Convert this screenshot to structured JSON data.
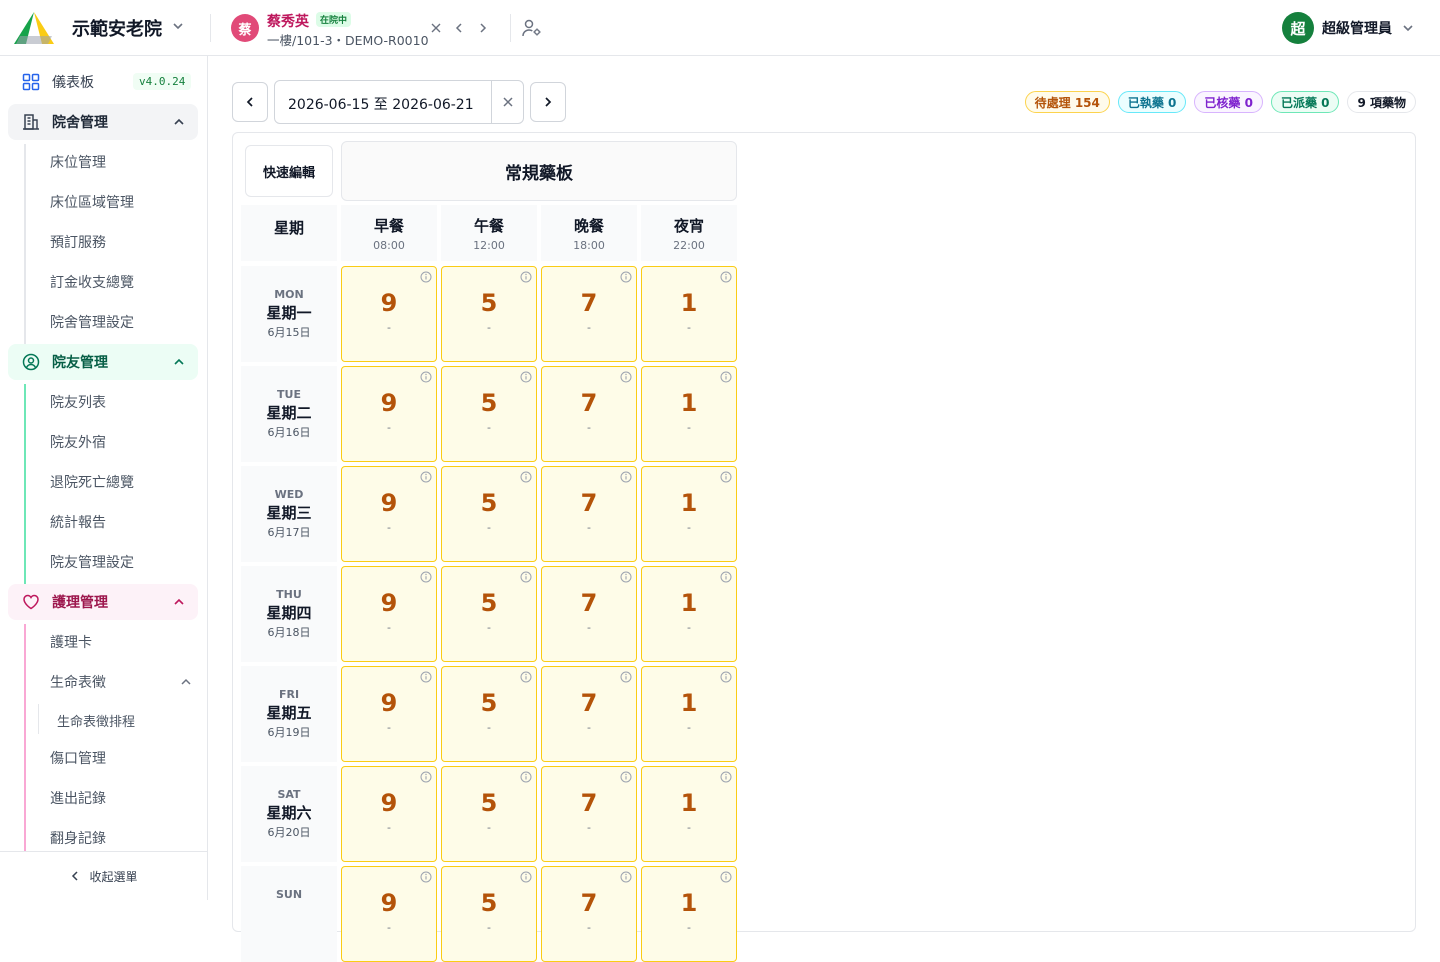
{
  "org": {
    "name": "示範安老院"
  },
  "patient": {
    "avatar": "蔡",
    "name": "蔡秀英",
    "status": "在院中",
    "location": "一樓/101-3・DEMO-R0010"
  },
  "admin": {
    "avatar": "超",
    "name": "超級管理員"
  },
  "sidebar": {
    "dashboard": "儀表板",
    "version": "v4.0.24",
    "groups": [
      {
        "label": "院舍管理",
        "items": [
          "床位管理",
          "床位區域管理",
          "預訂服務",
          "訂金收支總覽",
          "院舍管理設定"
        ]
      },
      {
        "label": "院友管理",
        "items": [
          "院友列表",
          "院友外宿",
          "退院死亡總覽",
          "統計報告",
          "院友管理設定"
        ]
      },
      {
        "label": "護理管理",
        "items": [
          "護理卡",
          "生命表徵",
          "生命表徵排程",
          "傷口管理",
          "進出記錄",
          "翻身記錄"
        ]
      }
    ],
    "collapse": "收起選單"
  },
  "toolbar": {
    "date_range": "2026-06-15 至 2026-06-21",
    "pills": [
      {
        "label": "待處理 154",
        "color": "#b45309",
        "bg": "#fffbeb",
        "border": "#fcd34d"
      },
      {
        "label": "已執藥 0",
        "color": "#0e7490",
        "bg": "#ecfeff",
        "border": "#67e8f9"
      },
      {
        "label": "已核藥 0",
        "color": "#7e22ce",
        "bg": "#faf5ff",
        "border": "#d8b4fe"
      },
      {
        "label": "已派藥 0",
        "color": "#047857",
        "bg": "#ecfdf5",
        "border": "#6ee7b7"
      },
      {
        "label": "9 項藥物",
        "color": "#111827",
        "bg": "#ffffff",
        "border": "#e5e7eb"
      }
    ]
  },
  "board": {
    "quick_edit": "快速編輯",
    "title": "常規藥板",
    "weekday_header": "星期",
    "meals": [
      {
        "name": "早餐",
        "time": "08:00"
      },
      {
        "name": "午餐",
        "time": "12:00"
      },
      {
        "name": "晚餐",
        "time": "18:00"
      },
      {
        "name": "夜宵",
        "time": "22:00"
      }
    ],
    "days": [
      {
        "abbr": "MON",
        "name": "星期一",
        "date": "6月15日",
        "counts": [
          "9",
          "5",
          "7",
          "1"
        ]
      },
      {
        "abbr": "TUE",
        "name": "星期二",
        "date": "6月16日",
        "counts": [
          "9",
          "5",
          "7",
          "1"
        ]
      },
      {
        "abbr": "WED",
        "name": "星期三",
        "date": "6月17日",
        "counts": [
          "9",
          "5",
          "7",
          "1"
        ]
      },
      {
        "abbr": "THU",
        "name": "星期四",
        "date": "6月18日",
        "counts": [
          "9",
          "5",
          "7",
          "1"
        ]
      },
      {
        "abbr": "FRI",
        "name": "星期五",
        "date": "6月19日",
        "counts": [
          "9",
          "5",
          "7",
          "1"
        ]
      },
      {
        "abbr": "SAT",
        "name": "星期六",
        "date": "6月20日",
        "counts": [
          "9",
          "5",
          "7",
          "1"
        ]
      },
      {
        "abbr": "SUN",
        "name": "",
        "date": "",
        "counts": [
          "9",
          "5",
          "7",
          "1"
        ]
      }
    ],
    "empty_mark": "-"
  }
}
